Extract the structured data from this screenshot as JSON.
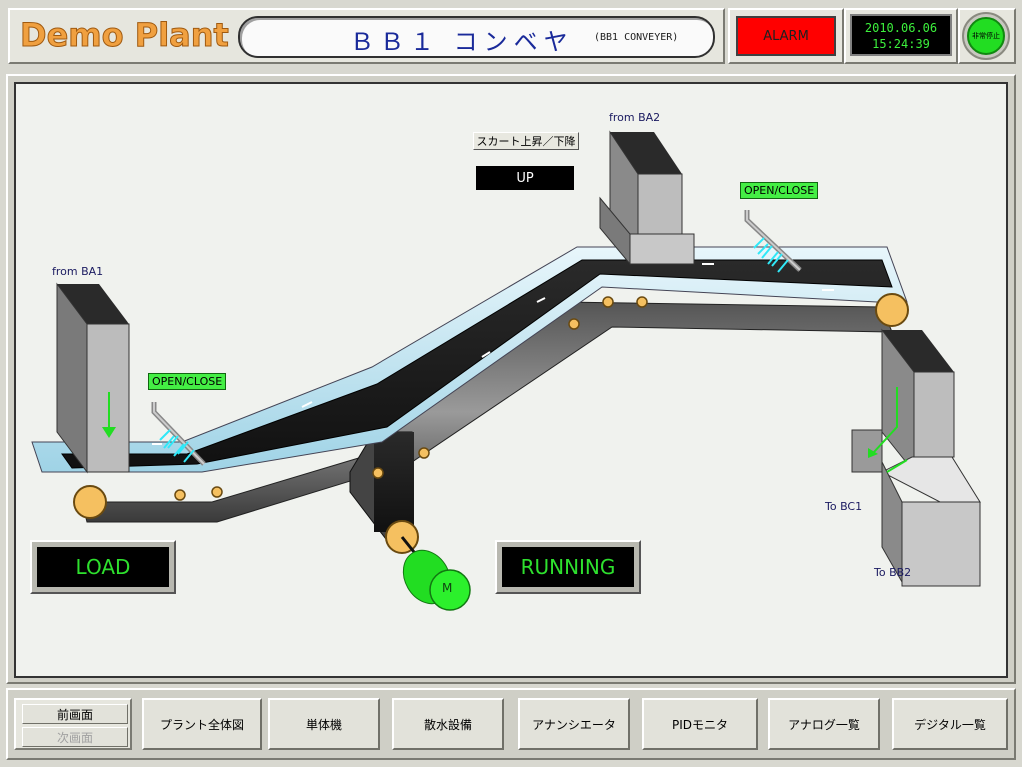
{
  "header": {
    "plant_name": "Demo Plant",
    "screen_title_jp": "ＢＢ１ コンベヤ",
    "screen_title_en": "(BB1 CONVEYER)",
    "alarm_label": "ALARM",
    "clock_date": "2010.06.06",
    "clock_time": "15:24:39",
    "estop_label": "非常停止"
  },
  "diagram": {
    "from_ba1": "from BA1",
    "from_ba2": "from BA2",
    "to_bc1": "To BC1",
    "to_bb2": "To BB2",
    "gate_left_label": "OPEN/CLOSE",
    "gate_right_label": "OPEN/CLOSE",
    "skirt_button_label": "スカート上昇／下降",
    "skirt_state": "UP",
    "motor_label": "M",
    "load_status": "LOAD",
    "run_status": "RUNNING"
  },
  "footer": {
    "prev_label": "前画面",
    "next_label": "次画面",
    "buttons": [
      "プラント全体図",
      "単体機",
      "散水設備",
      "アナンシエータ",
      "PIDモニタ",
      "アナログ一覧",
      "デジタル一覧"
    ]
  },
  "colors": {
    "alarm": "#ff0000",
    "status_text": "#2ee02e",
    "motor": "#22dd22",
    "title_text": "#1a2a9a",
    "plant_name": "#f0a040"
  }
}
